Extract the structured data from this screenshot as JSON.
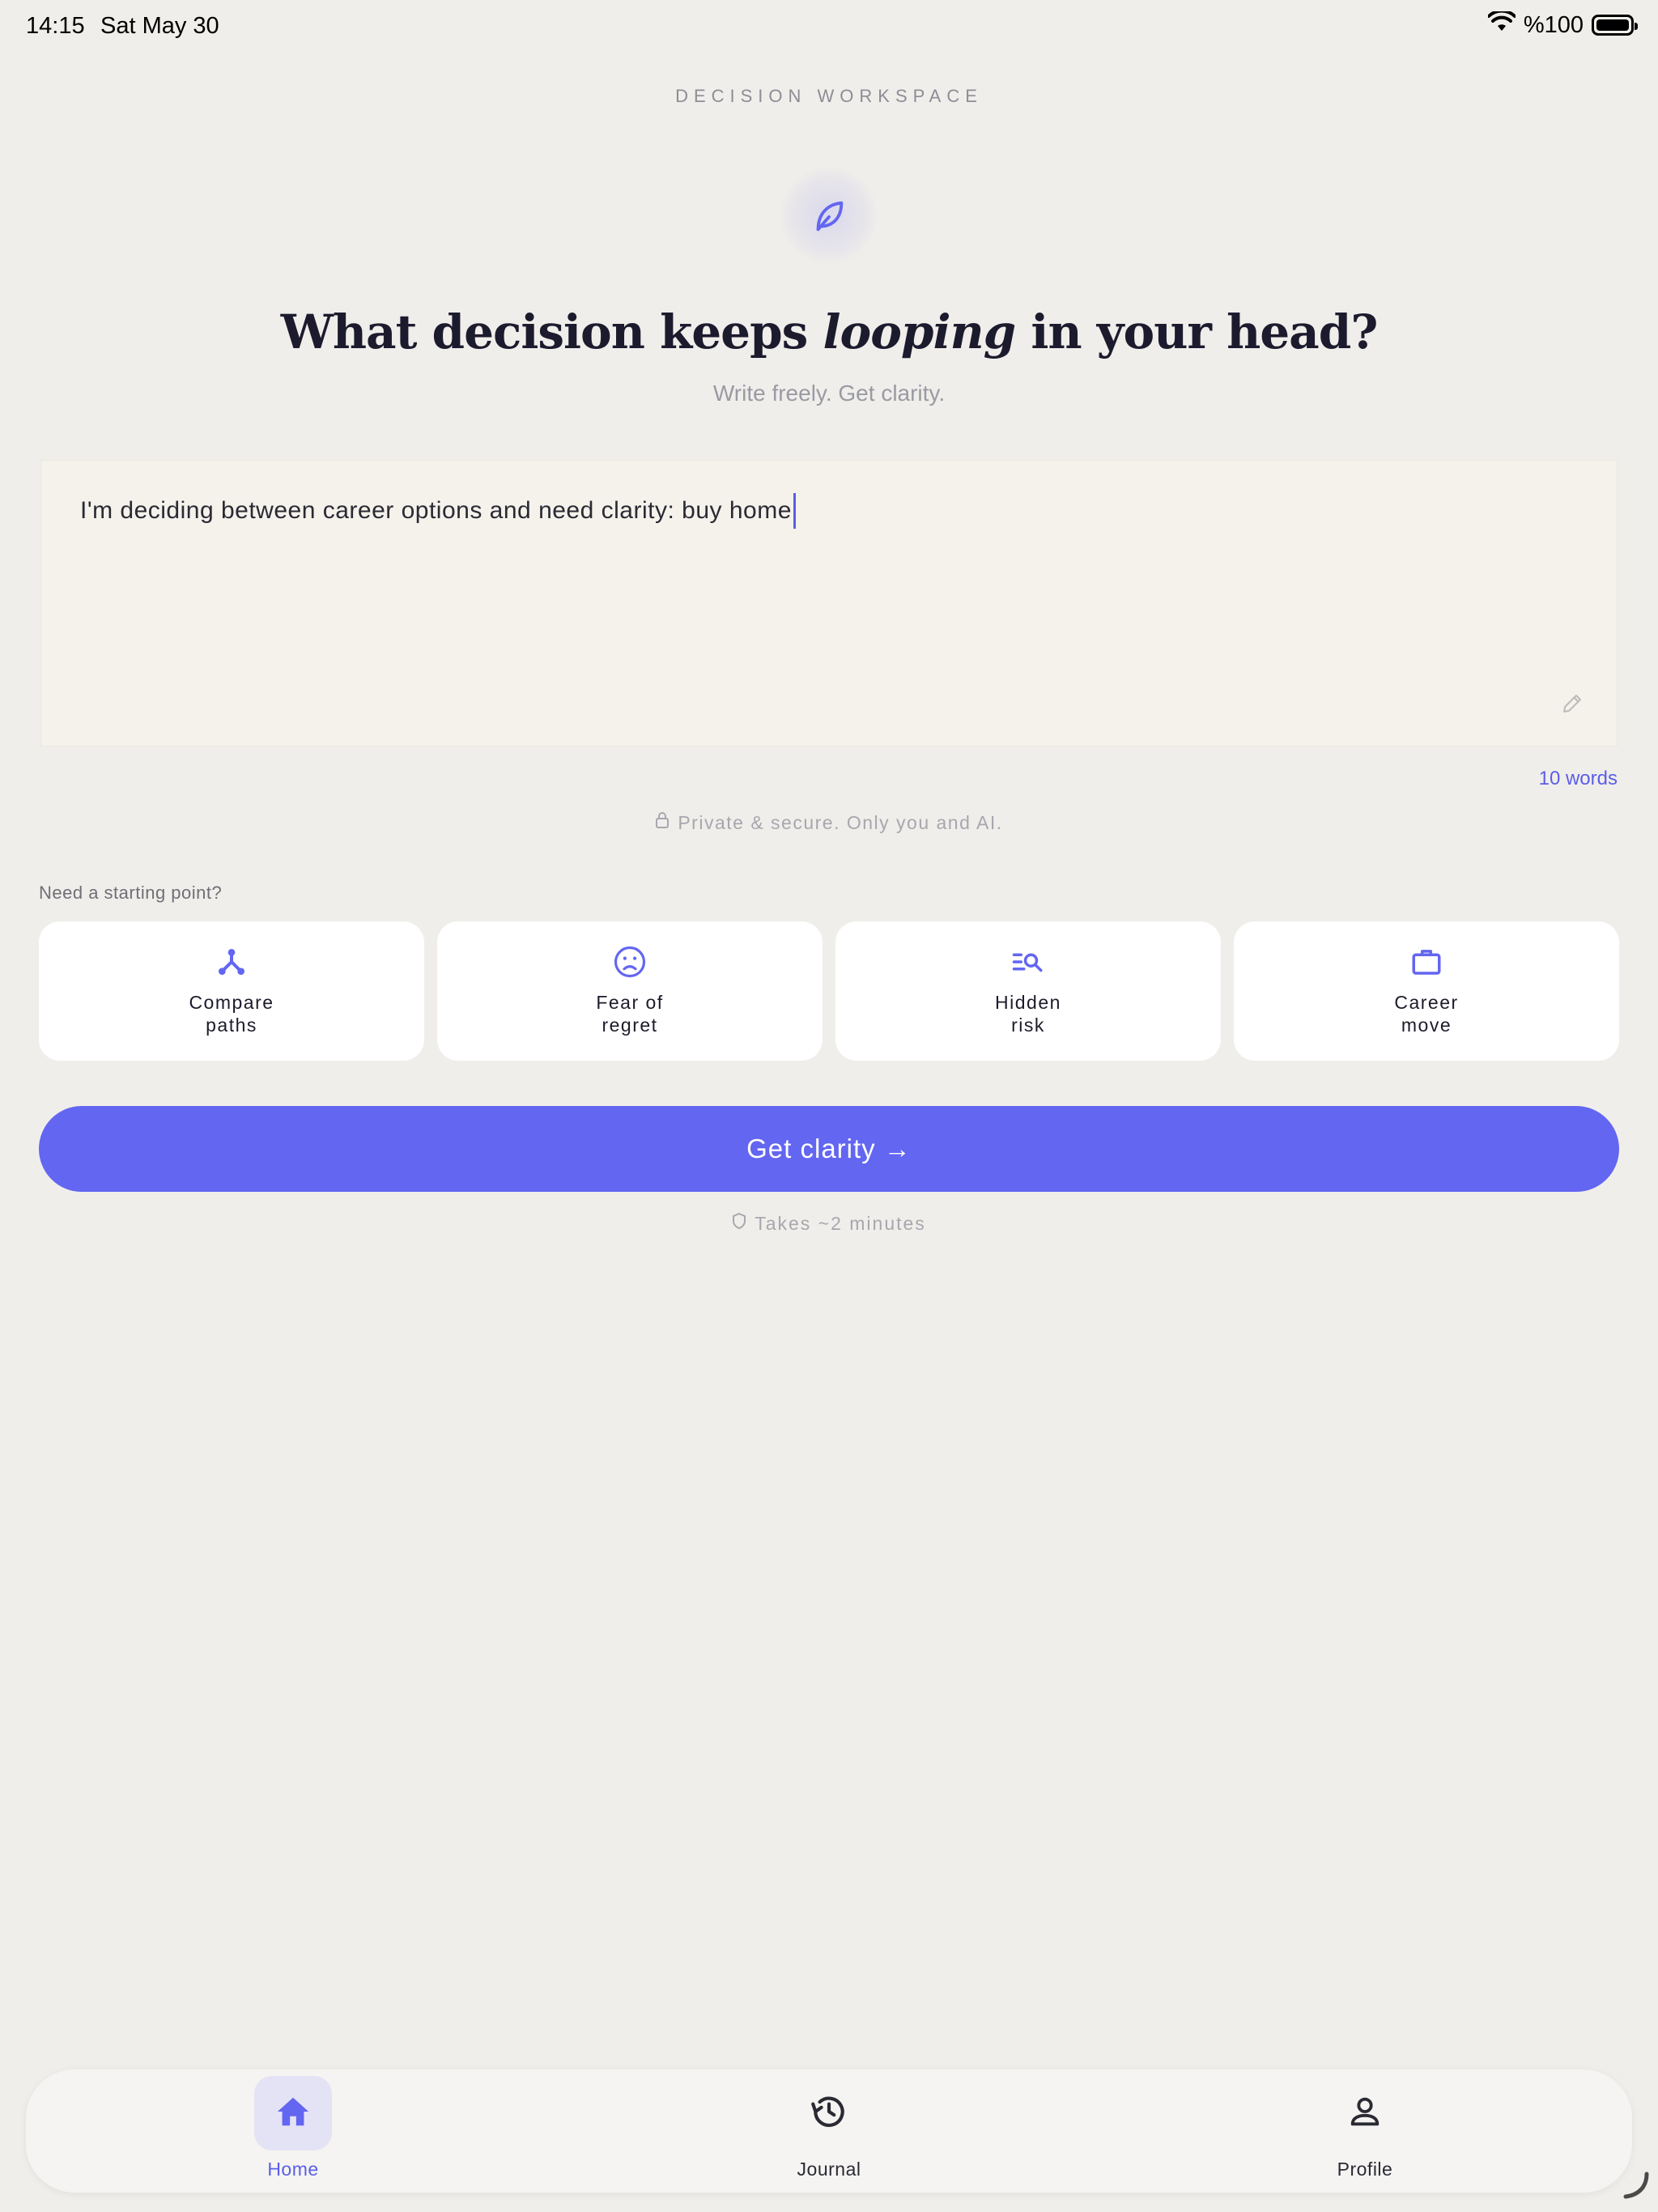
{
  "status_bar": {
    "time": "14:15",
    "date": "Sat May 30",
    "battery": "%100"
  },
  "header": {
    "eyebrow": "DECISION WORKSPACE",
    "icon": "leaf-icon",
    "title_before": "What decision keeps ",
    "title_emphasis": "looping",
    "title_after": " in your head?",
    "subtitle": "Write freely. Get clarity."
  },
  "editor": {
    "text": "I'm deciding between career options and need clarity: buy home",
    "word_count": "10 words",
    "privacy_note": "Private & secure. Only you and AI."
  },
  "starters": {
    "label": "Need a starting point?",
    "items": [
      {
        "label": "Compare paths",
        "icon": "fork-icon"
      },
      {
        "label": "Fear of regret",
        "icon": "sad-face-icon"
      },
      {
        "label": "Hidden risk",
        "icon": "search-list-icon"
      },
      {
        "label": "Career move",
        "icon": "briefcase-icon"
      }
    ]
  },
  "cta": {
    "label": "Get clarity →",
    "duration_note": "Takes ~2 minutes"
  },
  "tabbar": {
    "items": [
      {
        "label": "Home",
        "icon": "home-icon",
        "active": true
      },
      {
        "label": "Journal",
        "icon": "history-icon",
        "active": false
      },
      {
        "label": "Profile",
        "icon": "person-icon",
        "active": false
      }
    ]
  },
  "colors": {
    "accent": "#6366f1",
    "background": "#f0eeea",
    "editor_bg": "#f5f2ec",
    "card_bg": "#ffffff"
  }
}
